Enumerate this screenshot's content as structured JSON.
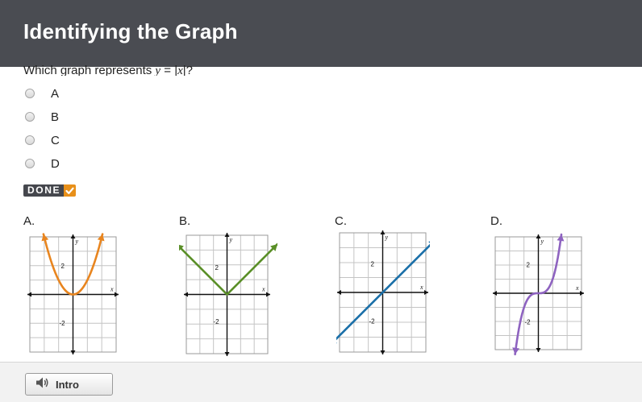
{
  "header": {
    "title": "Identifying the Graph"
  },
  "question": {
    "prefix": "Which graph represents ",
    "var_y": "y",
    "equals": " = |",
    "var_x": "x",
    "suffix": "|?"
  },
  "options": [
    {
      "label": "A"
    },
    {
      "label": "B"
    },
    {
      "label": "C"
    },
    {
      "label": "D"
    }
  ],
  "done_button": {
    "label": "DONE"
  },
  "graphs": [
    {
      "label": "A.",
      "x_axis": "x",
      "y_axis": "y",
      "tick_pos": "2",
      "tick_neg": "-2",
      "color": "#e8851f",
      "shape": "parabola"
    },
    {
      "label": "B.",
      "x_axis": "x",
      "y_axis": "y",
      "tick_pos": "2",
      "tick_neg": "-2",
      "color": "#5a8f28",
      "shape": "absolute-value"
    },
    {
      "label": "C.",
      "x_axis": "x",
      "y_axis": "y",
      "tick_pos": "2",
      "tick_neg": "-2",
      "color": "#1a6fa8",
      "shape": "line"
    },
    {
      "label": "D.",
      "x_axis": "x",
      "y_axis": "y",
      "tick_pos": "2",
      "tick_neg": "-2",
      "color": "#8e63c0",
      "shape": "cubic"
    }
  ],
  "footer": {
    "intro_label": "Intro",
    "intro_icon": "speaker-icon"
  },
  "colors": {
    "header_bg": "#4a4c52",
    "done_check": "#e8901a",
    "footer_bg": "#f2f2f2"
  }
}
